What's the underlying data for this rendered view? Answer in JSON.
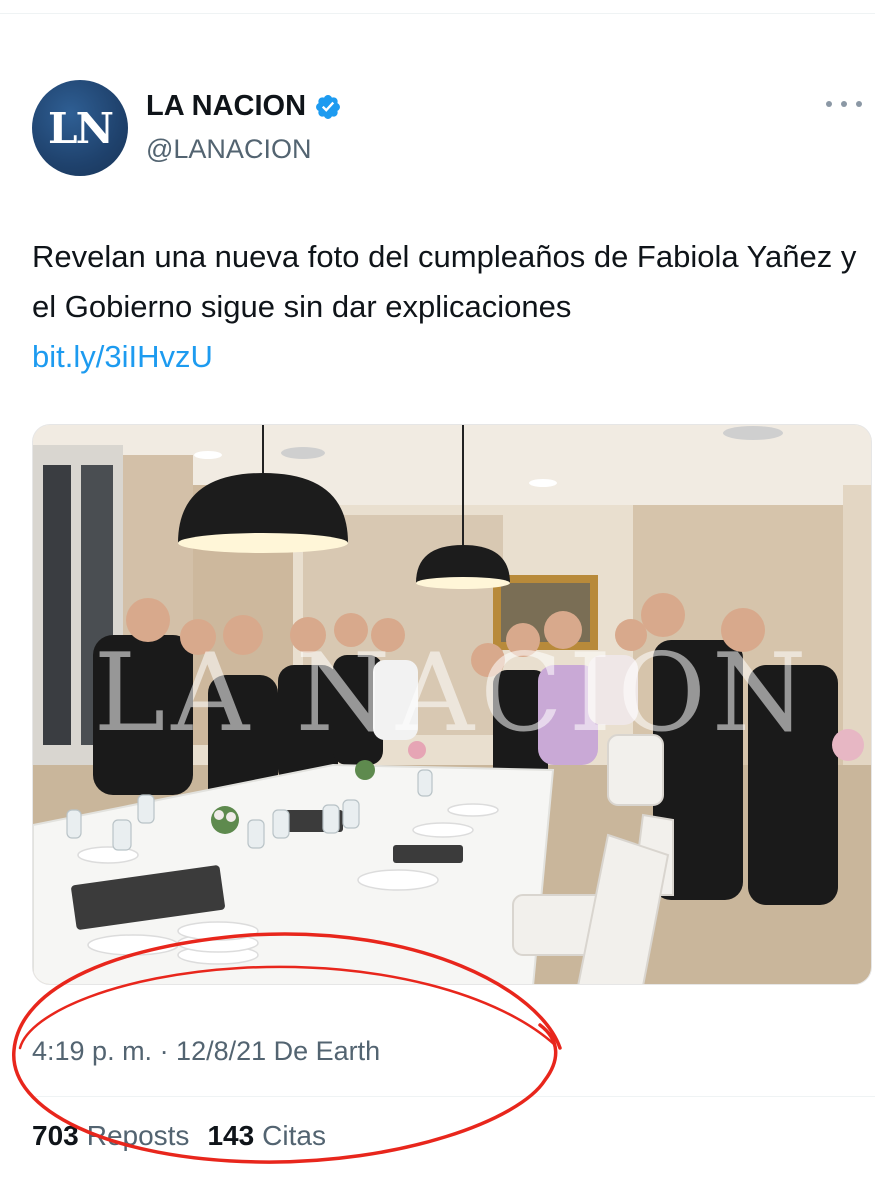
{
  "account": {
    "avatar_text": "LN",
    "display_name": "LA NACION",
    "handle": "@LANACION",
    "verified": true,
    "icons": {
      "verified": "verified-badge-icon",
      "more": "more-options-icon"
    }
  },
  "tweet": {
    "text": "Revelan una nueva foto del cumpleaños de Fabiola Yañez y el Gobierno sigue sin dar explicaciones",
    "link": "bit.ly/3iIHvzU",
    "photo_watermark": "LA NACION",
    "timestamp": "4:19 p. m. · 12/8/21 De Earth"
  },
  "stats": {
    "reposts_count": "703",
    "reposts_label": "Reposts",
    "quotes_count": "143",
    "quotes_label": "Citas"
  },
  "colors": {
    "link": "#1d9bf0",
    "verified": "#1d9bf0",
    "secondary_text": "#536471",
    "annotation": "#e8261c"
  }
}
